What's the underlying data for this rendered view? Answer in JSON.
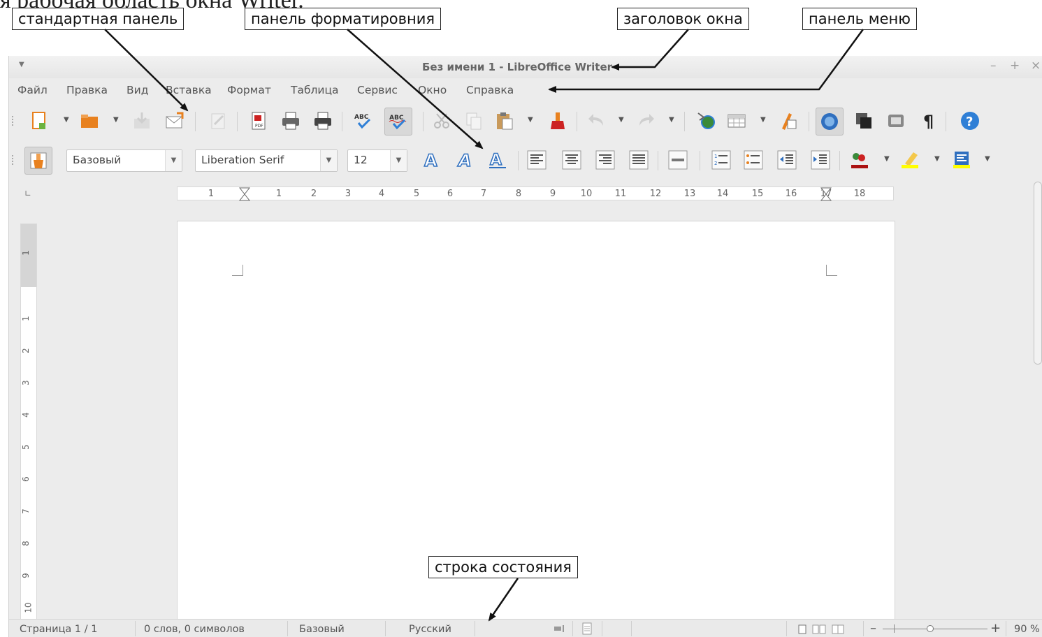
{
  "caption": "я рабочая область окна Writer.",
  "window": {
    "title": "Без имени 1 - LibreOffice Writer",
    "controls": [
      "–",
      "+",
      "×"
    ]
  },
  "menubar": [
    "Файл",
    "Правка",
    "Вид",
    "Вставка",
    "Формат",
    "Таблица",
    "Сервис",
    "Окно",
    "Справка"
  ],
  "toolbar_standard": {
    "icons": [
      "new-document-icon",
      "open-icon",
      "save-icon",
      "email-icon",
      "edit-mode-icon",
      "export-pdf-icon",
      "print-icon",
      "print-preview-icon",
      "spellcheck-icon",
      "autospellcheck-icon",
      "cut-icon",
      "copy-icon",
      "paste-icon",
      "clone-formatting-icon",
      "undo-icon",
      "redo-icon",
      "hyperlink-icon",
      "table-icon",
      "draw-functions-icon",
      "navigator-icon",
      "gallery-icon",
      "data-sources-icon",
      "formatting-marks-icon",
      "help-icon"
    ]
  },
  "toolbar_format": {
    "style_value": "Базовый",
    "font_value": "Liberation Serif",
    "size_value": "12",
    "pilcrow": "¶"
  },
  "ruler": {
    "numbers": [
      "1",
      "1",
      "2",
      "3",
      "4",
      "5",
      "6",
      "7",
      "8",
      "9",
      "10",
      "11",
      "12",
      "13",
      "14",
      "15",
      "16",
      "17",
      "18"
    ],
    "vertical_numbers": [
      "1",
      "1",
      "2",
      "3",
      "4",
      "5",
      "6",
      "7",
      "8",
      "9",
      "10"
    ]
  },
  "statusbar": {
    "page": "Страница 1 / 1",
    "words": "0 слов, 0 символов",
    "style": "Базовый",
    "language": "Русский",
    "zoom": "90 %"
  },
  "callouts": {
    "standard": "стандартная панель",
    "formatting": "панель форматировния",
    "title": "заголовок окна",
    "menu": "панель меню",
    "status": "строка состояния"
  },
  "colors": {
    "window_bg": "#ececec",
    "help_blue": "#2f7fd6",
    "accent_orange": "#e8811f",
    "callout_border": "#222222"
  }
}
